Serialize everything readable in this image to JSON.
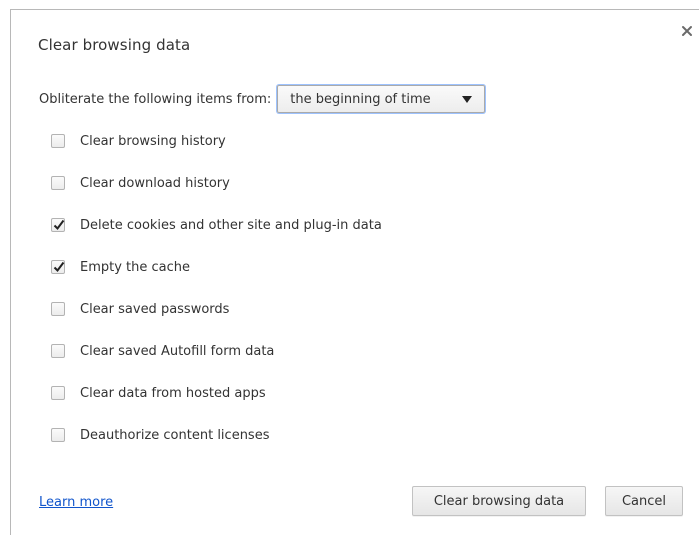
{
  "dialog": {
    "title": "Clear browsing data",
    "close_icon": "close-icon"
  },
  "range": {
    "label": "Obliterate the following items from:",
    "selected": "the beginning of time"
  },
  "options": [
    {
      "label": "Clear browsing history",
      "checked": false
    },
    {
      "label": "Clear download history",
      "checked": false
    },
    {
      "label": "Delete cookies and other site and plug-in data",
      "checked": true
    },
    {
      "label": "Empty the cache",
      "checked": true
    },
    {
      "label": "Clear saved passwords",
      "checked": false
    },
    {
      "label": "Clear saved Autofill form data",
      "checked": false
    },
    {
      "label": "Clear data from hosted apps",
      "checked": false
    },
    {
      "label": "Deauthorize content licenses",
      "checked": false
    }
  ],
  "footer": {
    "learn_more": "Learn more",
    "confirm_label": "Clear browsing data",
    "cancel_label": "Cancel"
  },
  "colors": {
    "link": "#1155cc",
    "focus_ring": "#4d90fe"
  }
}
